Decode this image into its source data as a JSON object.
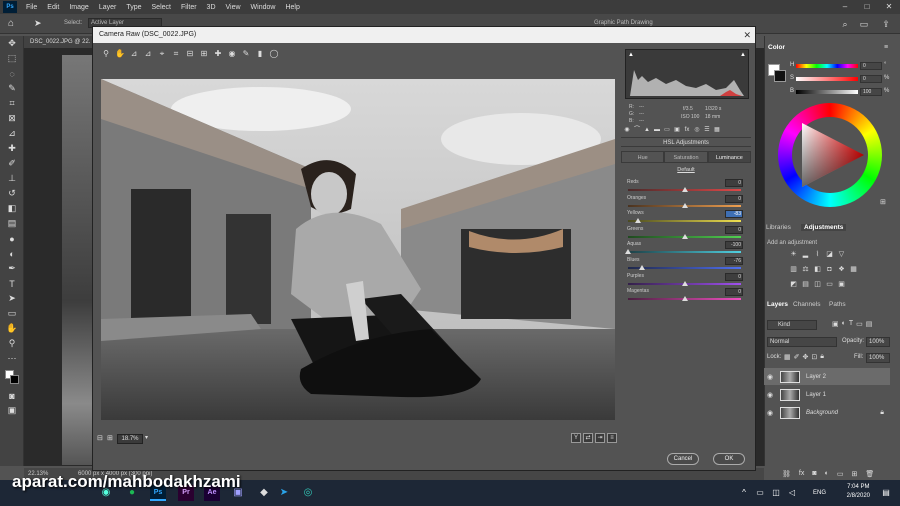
{
  "menubar": {
    "items": [
      "File",
      "Edit",
      "Image",
      "Layer",
      "Type",
      "Select",
      "Filter",
      "3D",
      "View",
      "Window",
      "Help"
    ],
    "ps_logo": "Ps"
  },
  "optbar": {
    "select_label": "Select:",
    "select_value": "Active Layer",
    "ref_text": "Graphic Path Drawing"
  },
  "doc": {
    "tab_title": "DSC_0022.JPG @ 22.",
    "status_zoom": "22.13%",
    "status_size": "6000 px x 4000 px (300 ppi)"
  },
  "camera_raw": {
    "title": "Camera Raw (DSC_0022.JPG)",
    "zoom": "18.7%",
    "camera_info": {
      "aperture": "f/3.5",
      "shutter": "1/320 s",
      "iso": "ISO 100",
      "focal": "18 mm",
      "r": "R:",
      "g": "G:",
      "b": "B:",
      "dash": "---"
    },
    "panel_title": "HSL Adjustments",
    "tabs": [
      {
        "label": "Hue",
        "active": false
      },
      {
        "label": "Saturation",
        "active": false
      },
      {
        "label": "Luminance",
        "active": true
      }
    ],
    "default_link": "Default",
    "sliders": [
      {
        "label": "Reds",
        "value": "0",
        "pos": 0.5,
        "grad": "linear-gradient(90deg,#4a2a2a,#e04848)"
      },
      {
        "label": "Oranges",
        "value": "0",
        "pos": 0.5,
        "grad": "linear-gradient(90deg,#4a3320,#f0a050)"
      },
      {
        "label": "Yellows",
        "value": "-83",
        "pos": 0.085,
        "grad": "linear-gradient(90deg,#4a4a20,#f0e050)",
        "selected": true
      },
      {
        "label": "Greens",
        "value": "0",
        "pos": 0.5,
        "grad": "linear-gradient(90deg,#204a20,#50d050)"
      },
      {
        "label": "Aquas",
        "value": "-100",
        "pos": 0.0,
        "grad": "linear-gradient(90deg,#1e4046,#50d0e0)"
      },
      {
        "label": "Blues",
        "value": "-76",
        "pos": 0.12,
        "grad": "linear-gradient(90deg,#20284a,#5070f0)"
      },
      {
        "label": "Purples",
        "value": "0",
        "pos": 0.5,
        "grad": "linear-gradient(90deg,#34204a,#a050f0)"
      },
      {
        "label": "Magentas",
        "value": "0",
        "pos": 0.5,
        "grad": "linear-gradient(90deg,#4a2040,#f050c0)"
      }
    ],
    "cancel_label": "Cancel",
    "ok_label": "OK"
  },
  "color_panel": {
    "title": "Color",
    "h_label": "H",
    "s_label": "S",
    "b_label": "B",
    "h_value": "0",
    "s_value": "0",
    "b_value": "100",
    "h_unit": "°",
    "s_unit": "%",
    "b_unit": "%"
  },
  "adjustments_panel": {
    "tab_libraries": "Libraries",
    "tab_adjustments": "Adjustments",
    "add_label": "Add an adjustment"
  },
  "layers_panel": {
    "tab_layers": "Layers",
    "tab_channels": "Channels",
    "tab_paths": "Paths",
    "kind_label": "Kind",
    "blend_mode": "Normal",
    "opacity_label": "Opacity:",
    "opacity_value": "100%",
    "lock_label": "Lock:",
    "fill_label": "Fill:",
    "fill_value": "100%",
    "layers": [
      {
        "name": "Layer 2",
        "selected": true
      },
      {
        "name": "Layer 1",
        "selected": false
      },
      {
        "name": "Background",
        "selected": false
      }
    ]
  },
  "taskbar": {
    "watermark": "aparat.com/mahbodakhzami",
    "lang": "ENG",
    "time": "7:04 PM",
    "date": "2/8/2020"
  }
}
